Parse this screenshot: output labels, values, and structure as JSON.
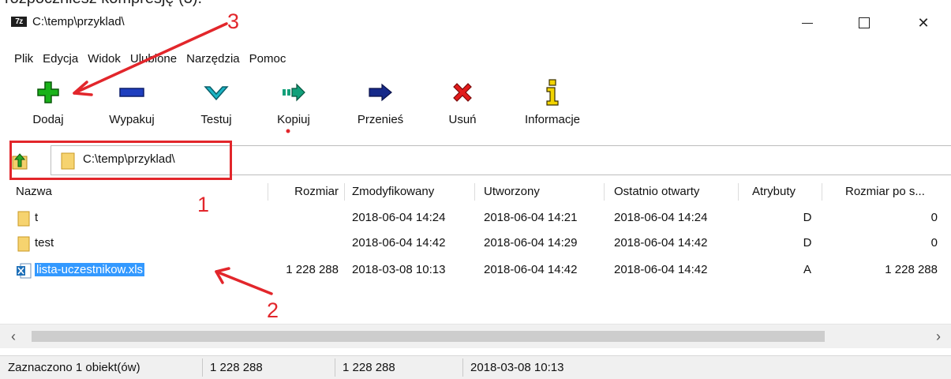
{
  "top_caption": "rozpoczniesz kompresję (3).",
  "window": {
    "app_icon_text": "7z",
    "title": "C:\\temp\\przyklad\\",
    "minimize_icon": "minimize-icon",
    "maximize_icon": "maximize-icon",
    "close_glyph": "✕"
  },
  "menu": [
    "Plik",
    "Edycja",
    "Widok",
    "Ulubione",
    "Narzędzia",
    "Pomoc"
  ],
  "toolbar": [
    {
      "label": "Dodaj",
      "icon": "plus-icon",
      "color": "#19b219"
    },
    {
      "label": "Wypakuj",
      "icon": "minus-icon",
      "color": "#1f3fbf"
    },
    {
      "label": "Testuj",
      "icon": "check-icon",
      "color": "#1ab4c4"
    },
    {
      "label": "Kopiuj",
      "icon": "copy-arrow-icon",
      "color": "#12a07a"
    },
    {
      "label": "Przenieś",
      "icon": "move-arrow-icon",
      "color": "#162a8a"
    },
    {
      "label": "Usuń",
      "icon": "delete-icon",
      "color": "#e21b1b"
    },
    {
      "label": "Informacje",
      "icon": "info-icon",
      "color": "#d8b400"
    }
  ],
  "address": {
    "path": "C:\\temp\\przyklad\\",
    "dropdown_glyph": "⌵"
  },
  "columns": [
    "Nazwa",
    "Rozmiar",
    "Zmodyfikowany",
    "Utworzony",
    "Ostatnio otwarty",
    "Atrybuty",
    "Rozmiar po s..."
  ],
  "rows": [
    {
      "icon": "folder-icon",
      "name": "t",
      "size": "",
      "modified": "2018-06-04 14:24",
      "created": "2018-06-04 14:21",
      "accessed": "2018-06-04 14:24",
      "attr": "D",
      "packed": "0"
    },
    {
      "icon": "folder-icon",
      "name": "test",
      "size": "",
      "modified": "2018-06-04 14:42",
      "created": "2018-06-04 14:29",
      "accessed": "2018-06-04 14:42",
      "attr": "D",
      "packed": "0"
    },
    {
      "icon": "excel-file-icon",
      "name": "lista-uczestnikow.xls",
      "size": "1 228 288",
      "modified": "2018-03-08 10:13",
      "created": "2018-06-04 14:42",
      "accessed": "2018-06-04 14:42",
      "attr": "A",
      "packed": "1 228 288",
      "selected": true
    }
  ],
  "scrollbar": {
    "left_glyph": "‹",
    "right_glyph": "›"
  },
  "status": {
    "selected": "Zaznaczono 1 obiekt(ów)",
    "size": "1 228 288",
    "packed": "1 228 288",
    "date": "2018-03-08 10:13"
  },
  "annotations": {
    "labels": [
      "1",
      "2",
      "3"
    ],
    "color": "#e2262b"
  }
}
